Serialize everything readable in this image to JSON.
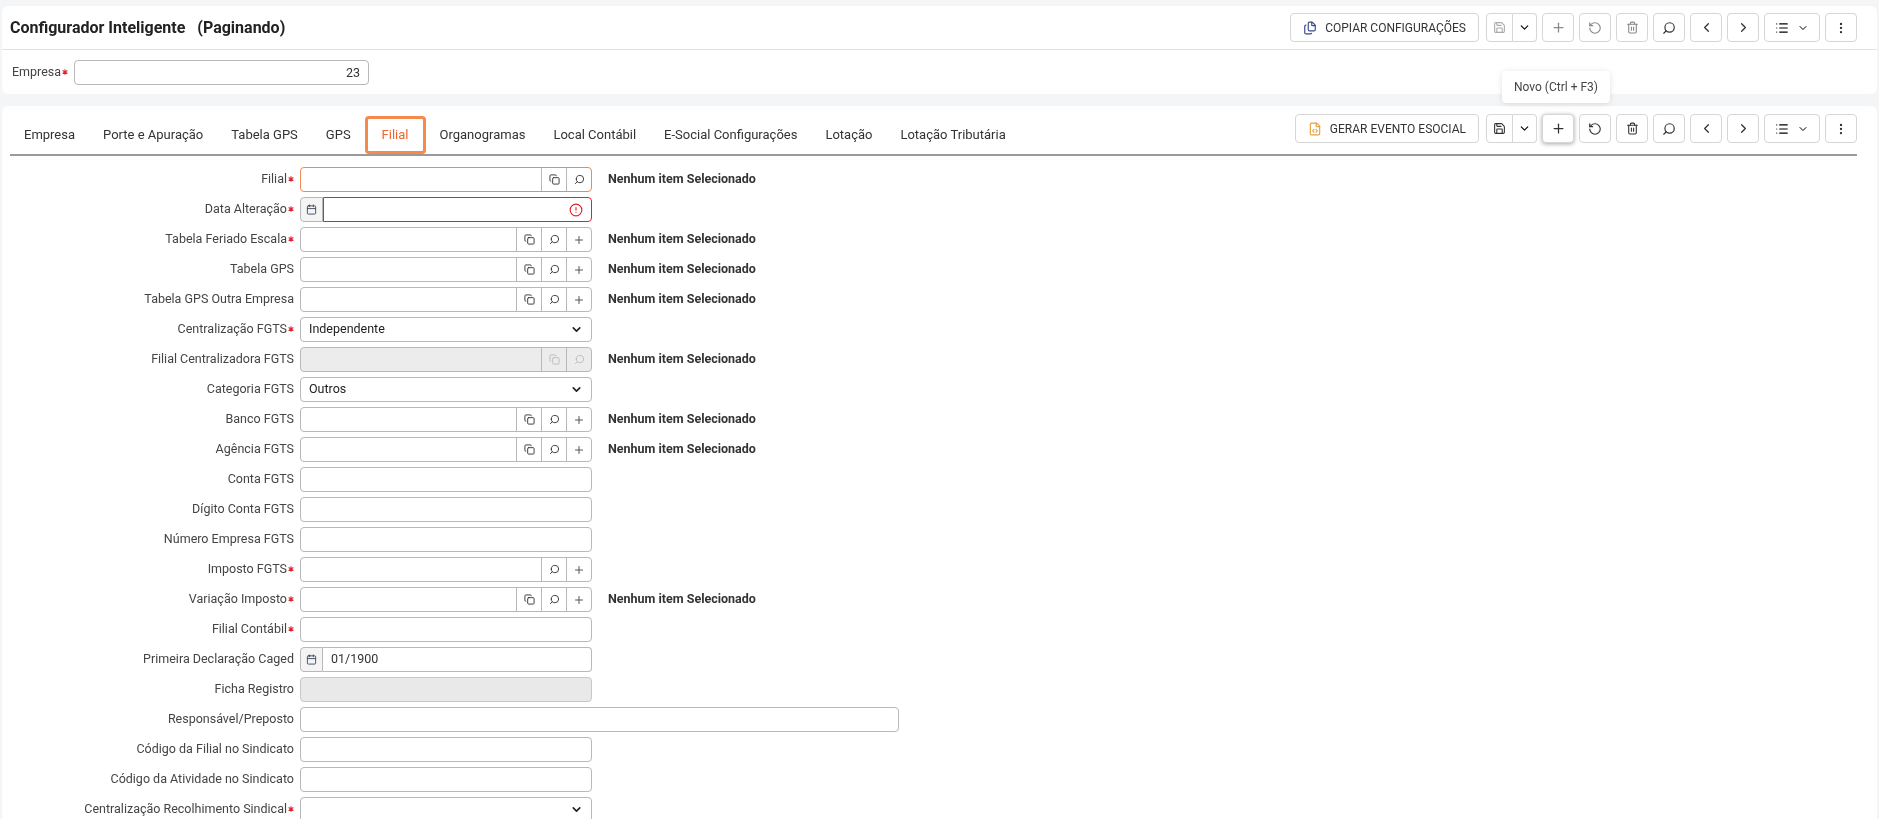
{
  "header": {
    "title": "Configurador Inteligente",
    "subtitle": "(Paginando)",
    "action": "COPIAR CONFIGURAÇÕES"
  },
  "empresa": {
    "label": "Empresa",
    "required": true,
    "value": "23"
  },
  "tabs": [
    {
      "label": "Empresa",
      "selected": false
    },
    {
      "label": "Porte e Apuração",
      "selected": false
    },
    {
      "label": "Tabela GPS",
      "selected": false
    },
    {
      "label": "GPS",
      "selected": false
    },
    {
      "label": "Filial",
      "selected": true
    },
    {
      "label": "Organogramas",
      "selected": false
    },
    {
      "label": "Local Contábil",
      "selected": false
    },
    {
      "label": "E-Social Configurações",
      "selected": false
    },
    {
      "label": "Lotação",
      "selected": false
    },
    {
      "label": "Lotação Tributária",
      "selected": false
    }
  ],
  "tab_action": "GERAR EVENTO ESOCIAL",
  "tooltip": "Novo (Ctrl + F3)",
  "fields": [
    {
      "label": "Filial",
      "required": true,
      "kind": "lookup",
      "copy": true,
      "add": false,
      "focused": true,
      "disabled": false,
      "note": "Nenhum item Selecionado"
    },
    {
      "label": "Data Alteração",
      "required": true,
      "kind": "date",
      "error": true
    },
    {
      "label": "Tabela Feriado Escala",
      "required": true,
      "kind": "lookup",
      "copy": true,
      "add": true,
      "focused": false,
      "disabled": false,
      "note": "Nenhum item Selecionado"
    },
    {
      "label": "Tabela GPS",
      "required": false,
      "kind": "lookup",
      "copy": true,
      "add": true,
      "focused": false,
      "disabled": false,
      "note": "Nenhum item Selecionado"
    },
    {
      "label": "Tabela GPS Outra Empresa",
      "required": false,
      "kind": "lookup",
      "copy": true,
      "add": true,
      "focused": false,
      "disabled": false,
      "note": "Nenhum item Selecionado"
    },
    {
      "label": "Centralização FGTS",
      "required": true,
      "kind": "select",
      "value": "Independente"
    },
    {
      "label": "Filial Centralizadora FGTS",
      "required": false,
      "kind": "lookup",
      "copy": true,
      "add": false,
      "focused": false,
      "disabled": true,
      "note": "Nenhum item Selecionado"
    },
    {
      "label": "Categoria FGTS",
      "required": false,
      "kind": "select",
      "value": "Outros"
    },
    {
      "label": "Banco FGTS",
      "required": false,
      "kind": "lookup",
      "copy": true,
      "add": true,
      "focused": false,
      "disabled": false,
      "note": "Nenhum item Selecionado"
    },
    {
      "label": "Agência FGTS",
      "required": false,
      "kind": "lookup",
      "copy": true,
      "add": true,
      "focused": false,
      "disabled": false,
      "note": "Nenhum item Selecionado"
    },
    {
      "label": "Conta FGTS",
      "required": false,
      "kind": "text"
    },
    {
      "label": "Dígito Conta FGTS",
      "required": false,
      "kind": "text"
    },
    {
      "label": "Número Empresa FGTS",
      "required": false,
      "kind": "text"
    },
    {
      "label": "Imposto FGTS",
      "required": true,
      "kind": "lookup",
      "copy": false,
      "add": true,
      "focused": false,
      "disabled": false
    },
    {
      "label": "Variação Imposto",
      "required": true,
      "kind": "lookup",
      "copy": true,
      "add": true,
      "focused": false,
      "disabled": false,
      "note": "Nenhum item Selecionado"
    },
    {
      "label": "Filial Contábil",
      "required": true,
      "kind": "text"
    },
    {
      "label": "Primeira Declaração Caged",
      "required": false,
      "kind": "date",
      "error": false,
      "value": "01/1900"
    },
    {
      "label": "Ficha Registro",
      "required": false,
      "kind": "locked"
    },
    {
      "label": "Responsável/Preposto",
      "required": false,
      "kind": "wide"
    },
    {
      "label": "Código da Filial no Sindicato",
      "required": false,
      "kind": "text"
    },
    {
      "label": "Código da Atividade no Sindicato",
      "required": false,
      "kind": "text"
    },
    {
      "label": "Centralização Recolhimento Sindical",
      "required": true,
      "kind": "select"
    }
  ]
}
